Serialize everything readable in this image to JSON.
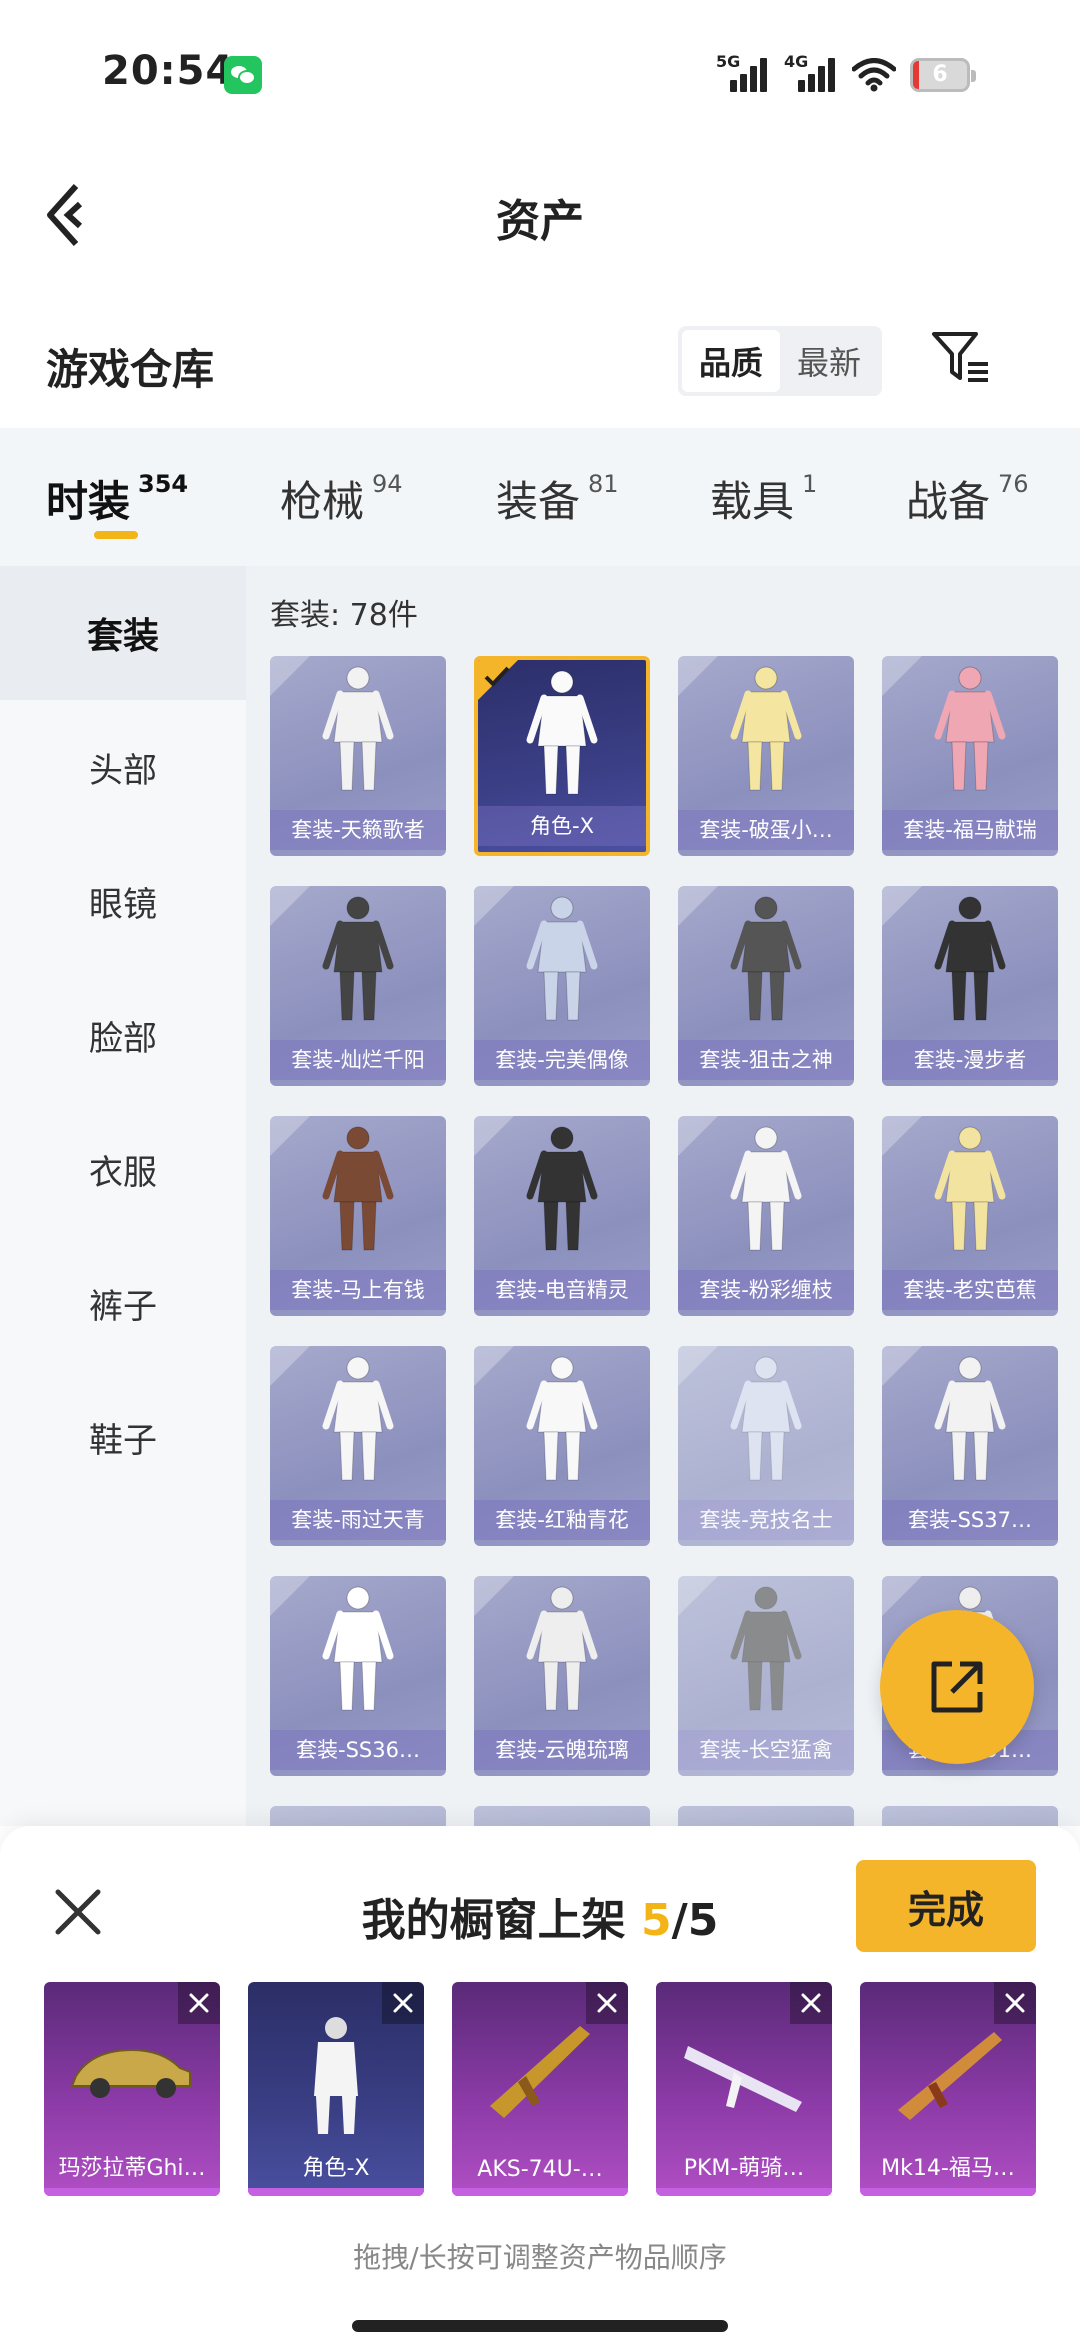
{
  "status_bar": {
    "time": "20:54",
    "signal1_label": "5G",
    "signal2_label": "4G",
    "battery": "6"
  },
  "nav": {
    "title": "资产"
  },
  "section": {
    "title": "游戏仓库",
    "sort_options": [
      "品质",
      "最新"
    ]
  },
  "tabs": [
    {
      "label": "时装",
      "count": "354"
    },
    {
      "label": "枪械",
      "count": "94"
    },
    {
      "label": "装备",
      "count": "81"
    },
    {
      "label": "载具",
      "count": "1"
    },
    {
      "label": "战备",
      "count": "76"
    }
  ],
  "sidebar": {
    "items": [
      "套装",
      "头部",
      "眼镜",
      "脸部",
      "衣服",
      "裤子",
      "鞋子"
    ]
  },
  "grid": {
    "count_label": "套装: 78件",
    "items": [
      "套装-天籁歌者",
      "角色-X",
      "套装-破蛋小…",
      "套装-福马献瑞",
      "套装-灿烂千阳",
      "套装-完美偶像",
      "套装-狙击之神",
      "套装-漫步者",
      "套装-马上有钱",
      "套装-电音精灵",
      "套装-粉彩缠枝",
      "套装-老实芭蕉",
      "套装-雨过天青",
      "套装-红釉青花",
      "套装-竞技名士",
      "套装-SS37…",
      "套装-SS36…",
      "套装-云魄琉璃",
      "套装-长空猛禽",
      "套装-SS31…"
    ]
  },
  "shelf": {
    "title": "我的橱窗上架",
    "current": "5",
    "total": "/5",
    "done_label": "完成",
    "items": [
      "玛莎拉蒂Ghi…",
      "角色-X",
      "AKS-74U-…",
      "PKM-萌骑…",
      "Mk14-福马…"
    ],
    "hint": "拖拽/长按可调整资产物品顺序"
  },
  "colors": {
    "accent": "#f5b52a",
    "card": "#9a9dc7",
    "selected_card": "#2c2f6a",
    "shelf_card": "#8b3aa6"
  }
}
